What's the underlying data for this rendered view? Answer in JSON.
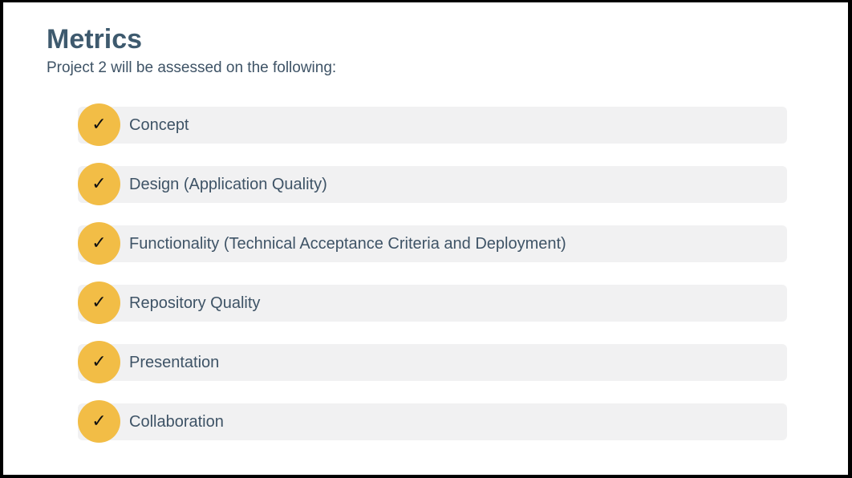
{
  "slide": {
    "title": "Metrics",
    "subtitle": "Project 2 will be assessed on the following:",
    "items": [
      {
        "label": "Concept",
        "icon": "checkmark-icon"
      },
      {
        "label": "Design (Application Quality)",
        "icon": "checkmark-icon"
      },
      {
        "label": "Functionality (Technical Acceptance Criteria and Deployment)",
        "icon": "checkmark-icon"
      },
      {
        "label": "Repository Quality",
        "icon": "checkmark-icon"
      },
      {
        "label": "Presentation",
        "icon": "checkmark-icon"
      },
      {
        "label": "Collaboration",
        "icon": "checkmark-icon"
      }
    ],
    "check_glyph": "✓"
  },
  "colors": {
    "title": "#3e5a6e",
    "text": "#3e5366",
    "accent": "#f2bd46",
    "bar": "#f1f1f2",
    "frame": "#000000"
  }
}
